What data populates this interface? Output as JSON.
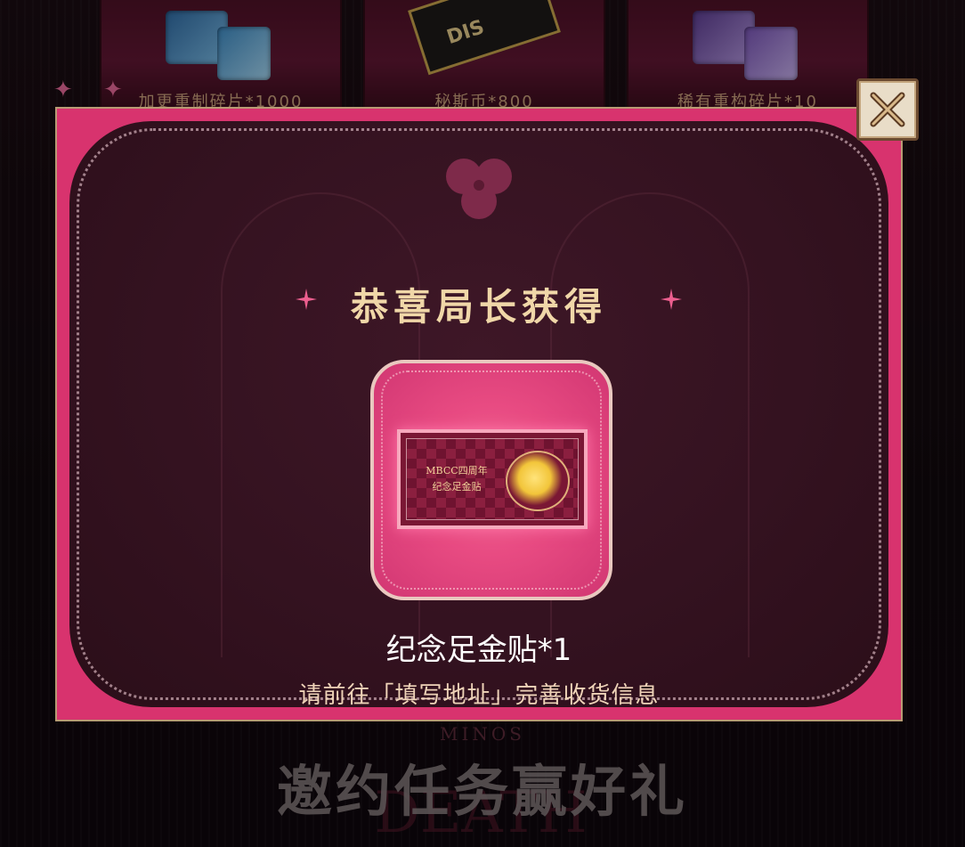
{
  "background": {
    "top_cards": [
      {
        "label": "加更重制碎片*1000",
        "tile_colors": [
          "#2d6ea6",
          "#3b8ec6"
        ]
      },
      {
        "label": "秘斯币*800",
        "badge": "DIS"
      },
      {
        "label": "稀有重构碎片*10",
        "tile_colors": [
          "#5b3d92",
          "#7956b8"
        ]
      }
    ],
    "banner": {
      "subtitle": "MINOS",
      "title": "邀约任务赢好礼",
      "logo": "DEATH"
    }
  },
  "dialog": {
    "title": "恭喜局长获得",
    "prize": {
      "ticket_line1": "MBCC四周年",
      "ticket_line2": "纪念足金贴",
      "name": "纪念足金贴*1",
      "hint": "请前往「填写地址」完善收货信息"
    },
    "close_icon": "close-x-icon"
  },
  "colors": {
    "accent_pink": "#d8336e",
    "gold_text": "#f0d7a8",
    "panel_bg": "#341220"
  }
}
